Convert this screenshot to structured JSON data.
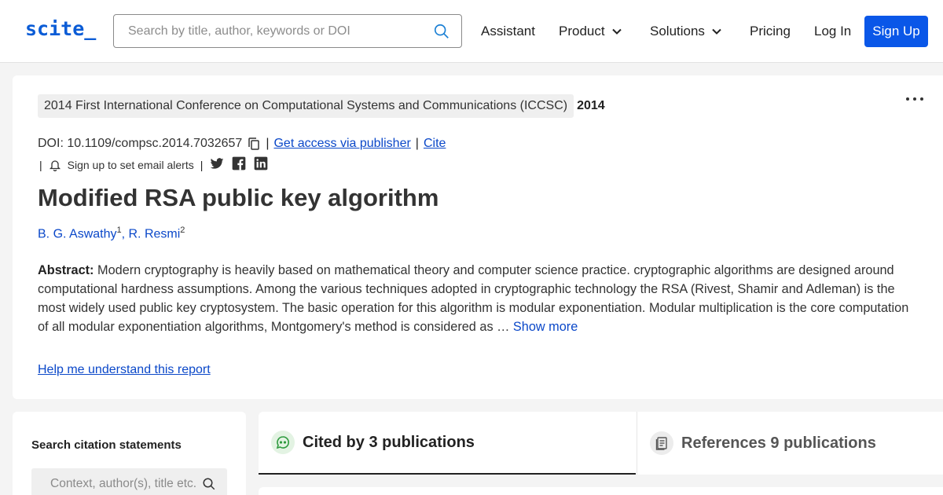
{
  "header": {
    "logo": "scite_",
    "search_placeholder": "Search by title, author, keywords or DOI",
    "nav": {
      "assistant": "Assistant",
      "product": "Product",
      "solutions": "Solutions",
      "pricing": "Pricing",
      "login": "Log In",
      "signup": "Sign Up"
    }
  },
  "paper": {
    "venue": "2014 First International Conference on Computational Systems and Communications (ICCSC)",
    "year": "2014",
    "doi": "DOI: 10.1109/compsc.2014.7032657",
    "access_link": "Get access via publisher",
    "cite_link": "Cite",
    "alerts_text": "Sign up to set email alerts",
    "title": "Modified RSA public key algorithm",
    "authors": [
      {
        "name": "B. G. Aswathy",
        "sup": "1"
      },
      {
        "name": "R. Resmi",
        "sup": "2"
      }
    ],
    "abstract_label": "Abstract:",
    "abstract_text": "Modern cryptography is heavily based on mathematical theory and computer science practice. cryptographic algorithms are designed around computational hardness assumptions. Among the various techniques adopted in cryptographic technology the RSA (Rivest, Shamir and Adleman) is the most widely used public key cryptosystem. The basic operation for this algorithm is modular exponentiation. Modular multiplication is the core computation of all modular exponentiation algorithms, Montgomery's method is considered as …",
    "show_more": "Show more",
    "help_link": "Help me understand this report"
  },
  "sidebar": {
    "title": "Search citation statements",
    "input_placeholder": "Context, author(s), title etc."
  },
  "tabs": {
    "cited": "Cited by 3 publications",
    "references": "References 9 publications"
  },
  "colors": {
    "brand": "#0b5cd6",
    "signup_bg": "#0a57e8",
    "link": "#0b48c9"
  }
}
